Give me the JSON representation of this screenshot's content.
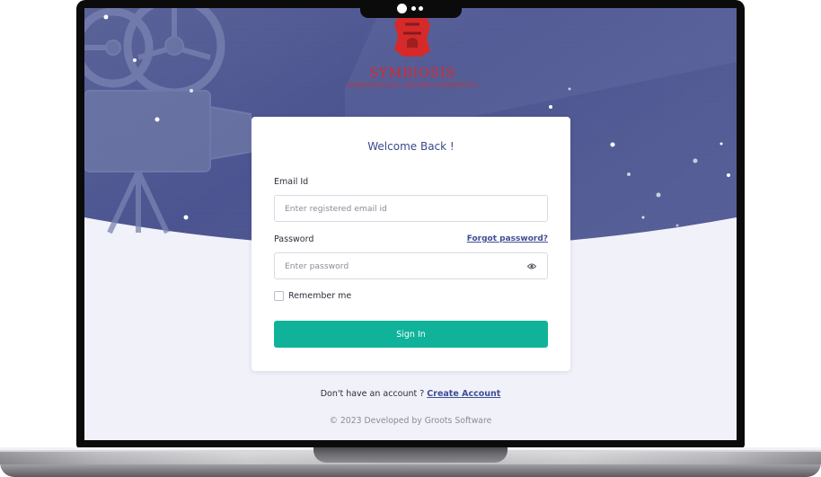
{
  "brand": {
    "name": "SYMBIOSIS",
    "subtitle": "INTERNATIONAL (DEEMED UNIVERSITY)"
  },
  "login": {
    "title": "Welcome Back !",
    "email_label": "Email Id",
    "email_placeholder": "Enter registered email id",
    "email_value": "",
    "password_label": "Password",
    "password_placeholder": "Enter password",
    "password_value": "",
    "forgot_label": "Forgot password?",
    "remember_label": "Remember me",
    "remember_checked": false,
    "signin_label": "Sign In",
    "password_toggle_icon": "eye-icon"
  },
  "signup": {
    "prompt": "Don't have an account ?",
    "link_label": "Create Account"
  },
  "footer": {
    "text": "© 2023 Developed by Groots Software"
  },
  "theme": {
    "hero_color": "#4d568f",
    "accent": "#10b39a",
    "link": "#3e4f95",
    "brand_red": "#d62a2a",
    "background": "#f1f1f9"
  }
}
